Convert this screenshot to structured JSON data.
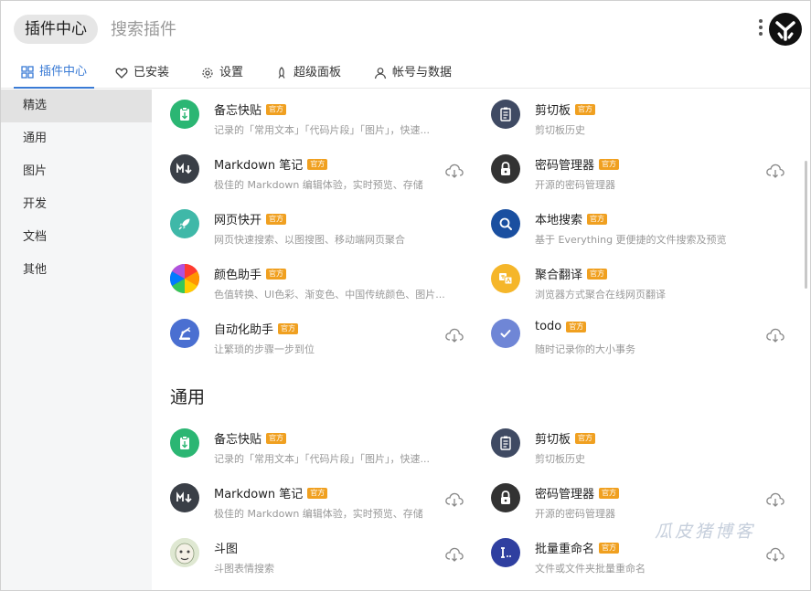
{
  "search": {
    "chip": "插件中心",
    "placeholder": "搜索插件"
  },
  "tabs": [
    {
      "label": "插件中心",
      "icon": "grid-icon",
      "active": true
    },
    {
      "label": "已安装",
      "icon": "heart-icon"
    },
    {
      "label": "设置",
      "icon": "gear-icon"
    },
    {
      "label": "超级面板",
      "icon": "rocket-icon"
    },
    {
      "label": "帐号与数据",
      "icon": "user-icon"
    }
  ],
  "sidebar": [
    {
      "label": "精选",
      "active": true
    },
    {
      "label": "通用"
    },
    {
      "label": "图片"
    },
    {
      "label": "开发"
    },
    {
      "label": "文档"
    },
    {
      "label": "其他"
    }
  ],
  "badge_label": "官方",
  "featured": [
    {
      "title": "备忘快贴",
      "desc": "记录的「常用文本」「代码片段」「图片」，快速...",
      "icon": "clipboard-icon",
      "color": "#2bb673",
      "official": true,
      "download": false
    },
    {
      "title": "剪切板",
      "desc": "剪切板历史",
      "icon": "clipboard-list-icon",
      "color": "#3f4a63",
      "official": true,
      "download": false
    },
    {
      "title": "Markdown 笔记",
      "desc": "极佳的 Markdown 编辑体验，实时预览、存储",
      "icon": "markdown-icon",
      "color": "#3a3f47",
      "official": true,
      "download": true
    },
    {
      "title": "密码管理器",
      "desc": "开源的密码管理器",
      "icon": "lock-icon",
      "color": "#333333",
      "official": true,
      "download": true
    },
    {
      "title": "网页快开",
      "desc": "网页快速搜索、以图搜图、移动端网页聚合",
      "icon": "rocket-icon",
      "color": "#3fb8a8",
      "official": true,
      "download": false
    },
    {
      "title": "本地搜索",
      "desc": "基于 Everything 更便捷的文件搜索及预览",
      "icon": "magnifier-icon",
      "color": "#1a4fa0",
      "official": true,
      "download": false
    },
    {
      "title": "颜色助手",
      "desc": "色值转换、UI色彩、渐变色、中国传统颜色、图片...",
      "icon": "color-wheel-icon",
      "color": "#e53935",
      "official": true,
      "download": false
    },
    {
      "title": "聚合翻译",
      "desc": "浏览器方式聚合在线网页翻译",
      "icon": "translate-icon",
      "color": "#f5b62a",
      "official": true,
      "download": false
    },
    {
      "title": "自动化助手",
      "desc": "让繁琐的步骤一步到位",
      "icon": "robot-arm-icon",
      "color": "#4a6fd1",
      "official": true,
      "download": true
    },
    {
      "title": "todo",
      "desc": "随时记录你的大小事务",
      "icon": "check-icon",
      "color": "#6f86d6",
      "official": true,
      "download": true
    }
  ],
  "section_title": "通用",
  "general": [
    {
      "title": "备忘快贴",
      "desc": "记录的「常用文本」「代码片段」「图片」，快速...",
      "icon": "clipboard-icon",
      "color": "#2bb673",
      "official": true,
      "download": false
    },
    {
      "title": "剪切板",
      "desc": "剪切板历史",
      "icon": "clipboard-list-icon",
      "color": "#3f4a63",
      "official": true,
      "download": false
    },
    {
      "title": "Markdown 笔记",
      "desc": "极佳的 Markdown 编辑体验，实时预览、存储",
      "icon": "markdown-icon",
      "color": "#3a3f47",
      "official": true,
      "download": true
    },
    {
      "title": "密码管理器",
      "desc": "开源的密码管理器",
      "icon": "lock-icon",
      "color": "#333333",
      "official": true,
      "download": true
    },
    {
      "title": "斗图",
      "desc": "斗图表情搜索",
      "icon": "meme-face-icon",
      "color": "#dfe8d2",
      "official": false,
      "download": true
    },
    {
      "title": "批量重命名",
      "desc": "文件或文件夹批量重命名",
      "icon": "rename-icon",
      "color": "#2f3fa0",
      "official": true,
      "download": true
    }
  ],
  "watermark": "瓜皮猪博客"
}
